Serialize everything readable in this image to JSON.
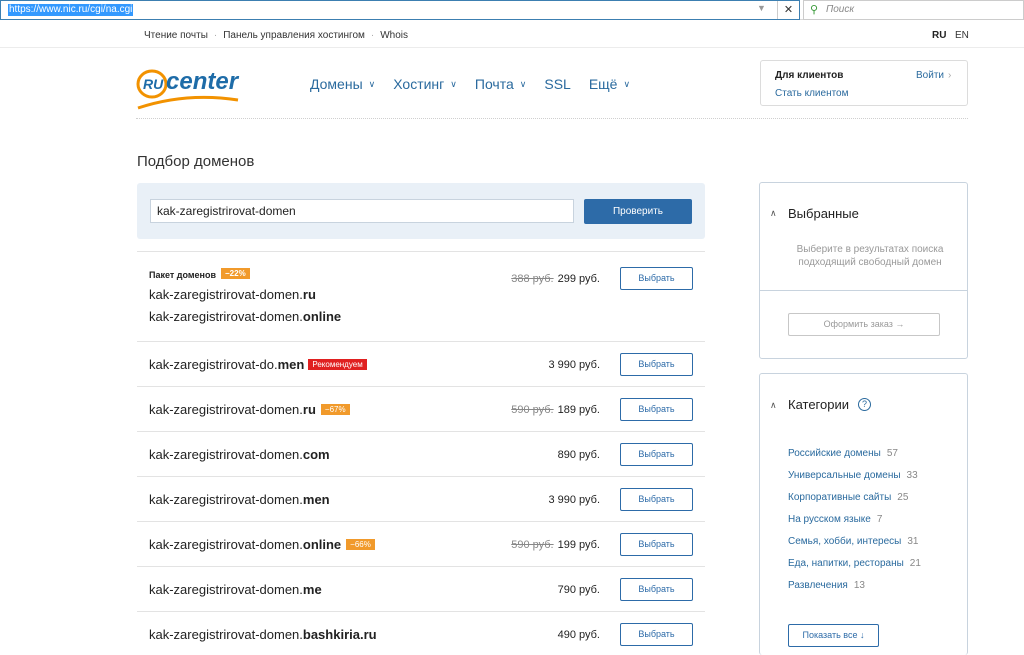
{
  "browser": {
    "url": "https://www.nic.ru/cgi/na.cgi",
    "search_placeholder": "Поиск"
  },
  "topline": {
    "links": [
      "Чтение почты",
      "Панель управления хостингом",
      "Whois"
    ],
    "lang_active": "RU",
    "lang_other": "EN"
  },
  "header": {
    "logo_ru": "RU",
    "logo_center": "center",
    "nav": [
      "Домены",
      "Хостинг",
      "Почта",
      "SSL",
      "Ещё"
    ],
    "client_title": "Для клиентов",
    "login": "Войти",
    "become_client": "Стать клиентом"
  },
  "main": {
    "title": "Подбор доменов",
    "search_value": "kak-zaregistrirovat-domen",
    "check_label": "Проверить",
    "select_label": "Выбрать",
    "package": {
      "title": "Пакет доменов",
      "discount": "−22%",
      "domains": [
        {
          "base": "kak-zaregistrirovat-domen.",
          "tld": "ru"
        },
        {
          "base": "kak-zaregistrirovat-domen.",
          "tld": "online"
        }
      ],
      "old_price": "388 руб.",
      "price": "299 руб."
    },
    "results": [
      {
        "base": "kak-zaregistrirovat-do.",
        "tld": "men",
        "recommended": "Рекомендуем",
        "discount": "",
        "old_price": "",
        "price": "3 990 руб."
      },
      {
        "base": "kak-zaregistrirovat-domen.",
        "tld": "ru",
        "recommended": "",
        "discount": "−67%",
        "old_price": "590 руб.",
        "price": "189 руб."
      },
      {
        "base": "kak-zaregistrirovat-domen.",
        "tld": "com",
        "recommended": "",
        "discount": "",
        "old_price": "",
        "price": "890 руб."
      },
      {
        "base": "kak-zaregistrirovat-domen.",
        "tld": "men",
        "recommended": "",
        "discount": "",
        "old_price": "",
        "price": "3 990 руб."
      },
      {
        "base": "kak-zaregistrirovat-domen.",
        "tld": "online",
        "recommended": "",
        "discount": "−66%",
        "old_price": "590 руб.",
        "price": "199 руб."
      },
      {
        "base": "kak-zaregistrirovat-domen.",
        "tld": "me",
        "recommended": "",
        "discount": "",
        "old_price": "",
        "price": "790 руб."
      },
      {
        "base": "kak-zaregistrirovat-domen.",
        "tld": "bashkiria.ru",
        "recommended": "",
        "discount": "",
        "old_price": "",
        "price": "490 руб."
      }
    ]
  },
  "sidebar": {
    "favorites_title": "Выбранные",
    "favorites_hint": "Выберите в результатах поиска подходящий свободный домен",
    "order_label": "Оформить заказ →",
    "categories_title": "Категории",
    "help": "?",
    "categories": [
      {
        "name": "Российские домены",
        "count": "57"
      },
      {
        "name": "Универсальные домены",
        "count": "33"
      },
      {
        "name": "Корпоративные сайты",
        "count": "25"
      },
      {
        "name": "На русском языке",
        "count": "7"
      },
      {
        "name": "Семья, хобби, интересы",
        "count": "31"
      },
      {
        "name": "Еда, напитки, рестораны",
        "count": "21"
      },
      {
        "name": "Развлечения",
        "count": "13"
      }
    ],
    "show_all": "Показать все ↓"
  },
  "colors": {
    "accent": "#2d6ba8",
    "discount": "#f19a2b",
    "recommended": "#e02020",
    "logo_orange": "#f29200",
    "logo_blue": "#1e6ca8"
  }
}
